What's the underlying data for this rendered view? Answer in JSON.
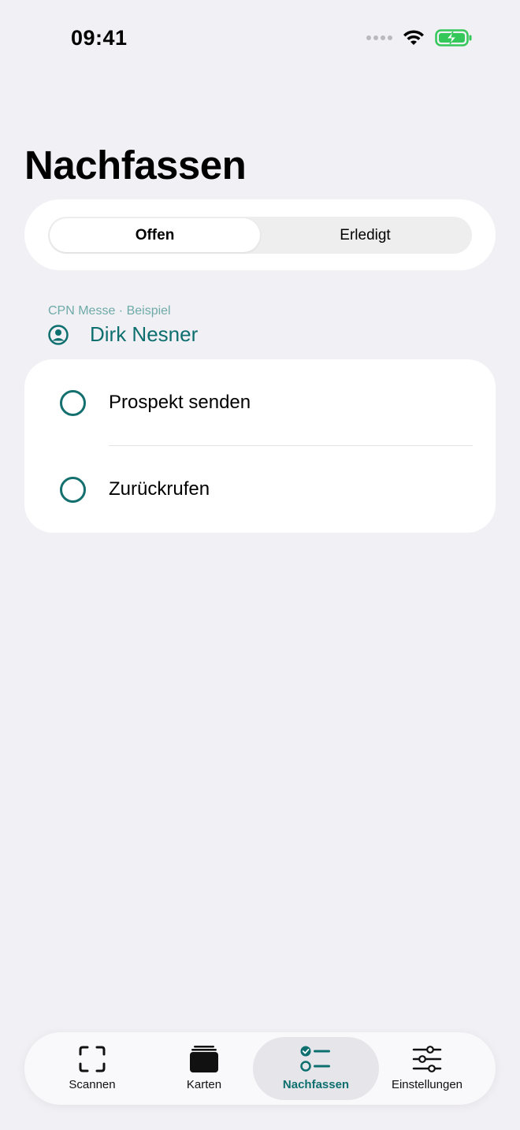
{
  "status_bar": {
    "time": "09:41"
  },
  "page": {
    "title": "Nachfassen"
  },
  "segments": {
    "open": "Offen",
    "done": "Erledigt"
  },
  "contact": {
    "event": "CPN Messe · Beispiel",
    "name": "Dirk Nesner"
  },
  "tasks": [
    {
      "label": "Prospekt senden",
      "done": false
    },
    {
      "label": "Zurückrufen",
      "done": false
    }
  ],
  "tabbar": {
    "scan": "Scannen",
    "cards": "Karten",
    "followup": "Nachfassen",
    "settings": "Einstellungen"
  },
  "colors": {
    "accent": "#0e6f6f",
    "background": "#f1f0f5",
    "battery": "#34c759"
  }
}
